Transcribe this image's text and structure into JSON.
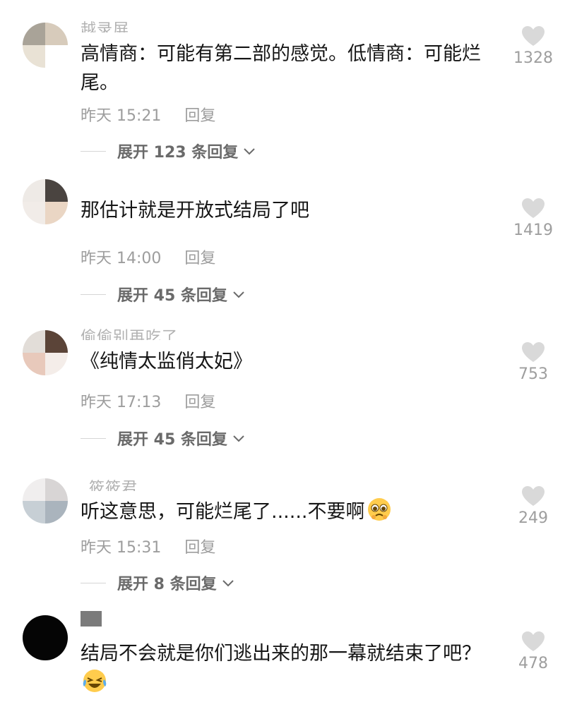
{
  "comments": [
    {
      "username": "越录屏",
      "text": "高情商：可能有第二部的感觉。低情商：可能烂尾。",
      "time": "昨天 15:21",
      "reply_label": "回复",
      "expand_label": "展开 123 条回复",
      "likes": "1328"
    },
    {
      "username": "",
      "text": "那估计就是开放式结局了吧",
      "time": "昨天 14:00",
      "reply_label": "回复",
      "expand_label": "展开 45 条回复",
      "likes": "1419"
    },
    {
      "username": "偷偷别再吃了",
      "text": "《纯情太监俏太妃》",
      "time": "昨天 17:13",
      "reply_label": "回复",
      "expand_label": "展开 45 条回复",
      "likes": "753"
    },
    {
      "username": "_筱筱君",
      "text": "听这意思，可能烂尾了......不要啊",
      "time": "昨天 15:31",
      "reply_label": "回复",
      "expand_label": "展开 8 条回复",
      "likes": "249",
      "emoji": "pleading-face-emoji"
    },
    {
      "username": "",
      "text": "结局不会就是你们逃出来的那一幕就结束了吧？",
      "likes": "478",
      "emoji": "laughing-crying-emoji"
    }
  ],
  "icons": {
    "like": "heart-icon",
    "expand": "chevron-down-icon"
  },
  "colors": {
    "text": "#161616",
    "meta": "#9d9d9d",
    "heart": "#d9d9d9",
    "expand": "#6a6a6a"
  }
}
